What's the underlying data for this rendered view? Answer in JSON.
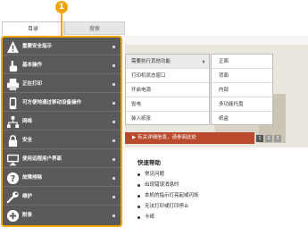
{
  "callout": {
    "number": "1"
  },
  "tabs": {
    "toc": "目录",
    "search": "搜索"
  },
  "sidebar": {
    "items": [
      {
        "label": "重要安全指示",
        "icon": "warning-icon"
      },
      {
        "label": "基本操作",
        "icon": "hand-icon"
      },
      {
        "label": "正在打印",
        "icon": "printer-icon"
      },
      {
        "label": "可方便地通过移动设备操作",
        "icon": "mobile-icon"
      },
      {
        "label": "网络",
        "icon": "network-icon"
      },
      {
        "label": "安全",
        "icon": "lock-icon"
      },
      {
        "label": "使用远程用户界面",
        "icon": "remote-ui-icon"
      },
      {
        "label": "故障排除",
        "icon": "question-icon"
      },
      {
        "label": "维护",
        "icon": "wrench-icon"
      },
      {
        "label": "附录",
        "icon": "plus-icon"
      }
    ]
  },
  "menu": {
    "items": [
      "需要执行其他功能",
      "打印机状态窗口",
      "开启电源",
      "省电",
      "装入纸张"
    ]
  },
  "submenu": {
    "items": [
      "正面",
      "背面",
      "内部",
      "多功能托盘",
      "纸盒"
    ]
  },
  "hero": {
    "banner": "▶ 有关详细信息，请参阅此处",
    "pages": [
      "1",
      "2",
      "3"
    ]
  },
  "help": {
    "title": "快速帮助",
    "items": [
      "常见问题",
      "出现错误消息时",
      "本机的指示灯亮起或闪烁",
      "无法打印或打印停止",
      "卡纸"
    ]
  },
  "colors": {
    "accent": "#f2a400",
    "sidebar": "#5a5a5a",
    "banner": "#b94a2e"
  }
}
